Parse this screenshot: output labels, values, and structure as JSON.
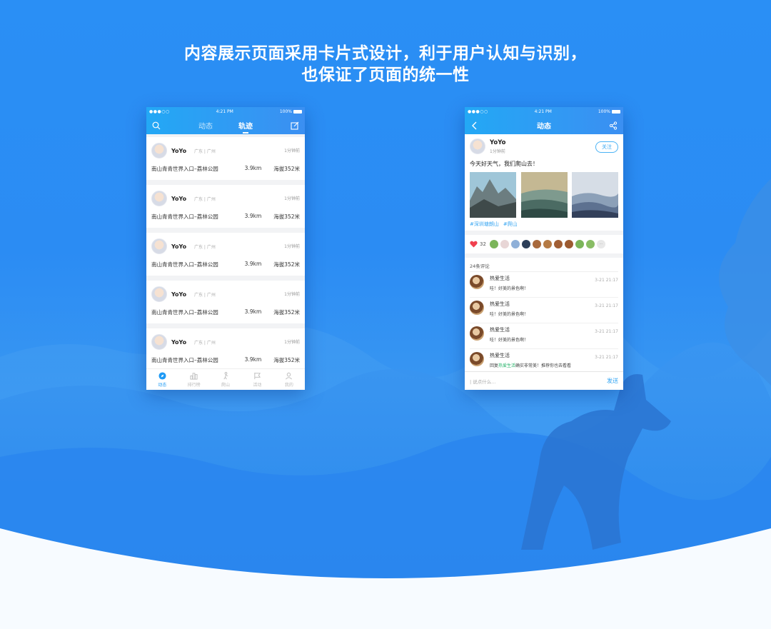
{
  "headline": {
    "line1": "内容展示页面采用卡片式设计，利于用户认知与识别，",
    "line2": "也保证了页面的统一性"
  },
  "colors": {
    "accent": "#1e9af5",
    "gradient_start": "#23a8f5",
    "gradient_end": "#3b8ff2",
    "tag": "#3aa7f2",
    "highlight": "#27b36b"
  },
  "left_phone": {
    "status": {
      "carrier": "●●●○○",
      "time": "4:21 PM",
      "battery": "100%"
    },
    "nav": {
      "search_icon": "search-icon",
      "tabs": [
        "动态",
        "轨迹"
      ],
      "active_tab": "轨迹",
      "edit_icon": "edit-icon"
    },
    "cards": [
      {
        "name": "YoYo",
        "loc": "广东 | 广州",
        "time": "1分钟前",
        "route": "南山青青世界入口–荔林公园",
        "distance": "3.9km",
        "altitude": "海拔352米"
      },
      {
        "name": "YoYo",
        "loc": "广东 | 广州",
        "time": "1分钟前",
        "route": "南山青青世界入口–荔林公园",
        "distance": "3.9km",
        "altitude": "海拔352米"
      },
      {
        "name": "YoYo",
        "loc": "广东 | 广州",
        "time": "1分钟前",
        "route": "南山青青世界入口–荔林公园",
        "distance": "3.9km",
        "altitude": "海拔352米"
      },
      {
        "name": "YoYo",
        "loc": "广东 | 广州",
        "time": "1分钟前",
        "route": "南山青青世界入口–荔林公园",
        "distance": "3.9km",
        "altitude": "海拔352米"
      },
      {
        "name": "YoYo",
        "loc": "广东 | 广州",
        "time": "1分钟前",
        "route": "南山青青世界入口–荔林公园",
        "distance": "3.9km",
        "altitude": "海拔352米"
      }
    ],
    "tabbar": [
      {
        "label": "动态",
        "icon": "compass-icon",
        "active": true
      },
      {
        "label": "排行榜",
        "icon": "ranking-icon",
        "active": false
      },
      {
        "label": "爬山",
        "icon": "hiker-icon",
        "active": false
      },
      {
        "label": "活动",
        "icon": "flag-icon",
        "active": false
      },
      {
        "label": "我的",
        "icon": "user-icon",
        "active": false
      }
    ]
  },
  "right_phone": {
    "status": {
      "carrier": "●●●○○",
      "time": "4:21 PM",
      "battery": "100%"
    },
    "nav": {
      "back_icon": "back-icon",
      "title": "动态",
      "share_icon": "share-icon"
    },
    "post": {
      "name": "YoYo",
      "time": "1分钟前",
      "follow_label": "关注",
      "text": "今天好天气，我们爬山去！",
      "tags": [
        "#深圳塘朗山",
        "#爬山"
      ]
    },
    "likes": {
      "count": "32",
      "more": "···"
    },
    "comments": {
      "header": "24条评论",
      "items": [
        {
          "name": "热爱生活",
          "text": "哇！好美的景色啊！",
          "date": "3-21 21:17"
        },
        {
          "name": "热爱生活",
          "text": "哇！好美的景色啊！",
          "date": "3-21 21:17"
        },
        {
          "name": "热爱生活",
          "text": "哇！好美的景色啊！",
          "date": "3-21 21:17"
        },
        {
          "name": "热爱生活",
          "reply_prefix": "回复",
          "reply_to": "热爱生活",
          "reply_text": "确实非常美！推荐你也去看看",
          "date": "3-21 21:17"
        }
      ]
    },
    "input": {
      "placeholder": "| 说点什么...",
      "send_label": "发送"
    }
  }
}
